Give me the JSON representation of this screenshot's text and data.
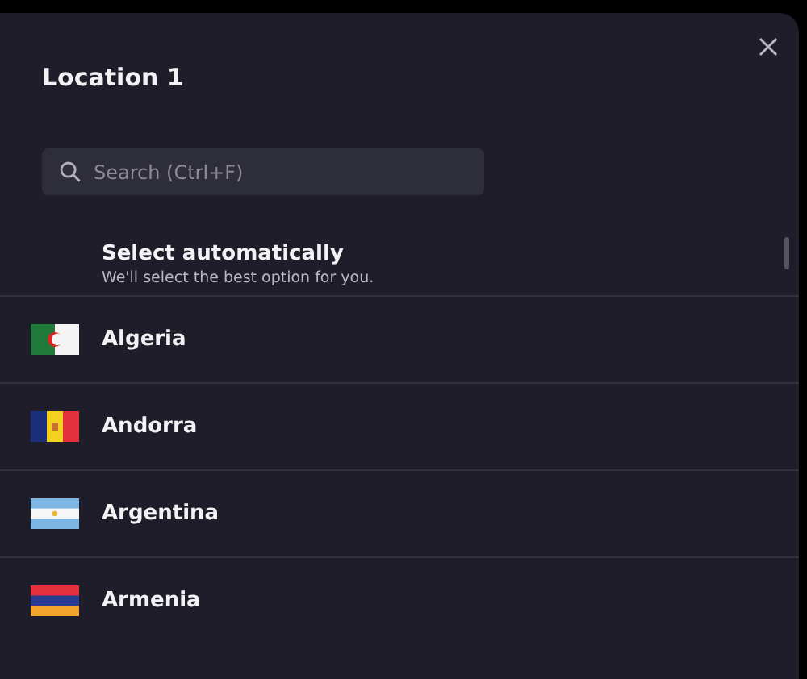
{
  "dialog": {
    "title": "Location 1"
  },
  "search": {
    "placeholder": "Search (Ctrl+F)"
  },
  "auto_option": {
    "title": "Select automatically",
    "subtitle": "We'll select the best option for you."
  },
  "countries": [
    {
      "name": "Algeria",
      "kind": "algeria"
    },
    {
      "name": "Andorra",
      "kind": "andorra"
    },
    {
      "name": "Argentina",
      "kind": "argentina"
    },
    {
      "name": "Armenia",
      "kind": "armenia"
    }
  ]
}
